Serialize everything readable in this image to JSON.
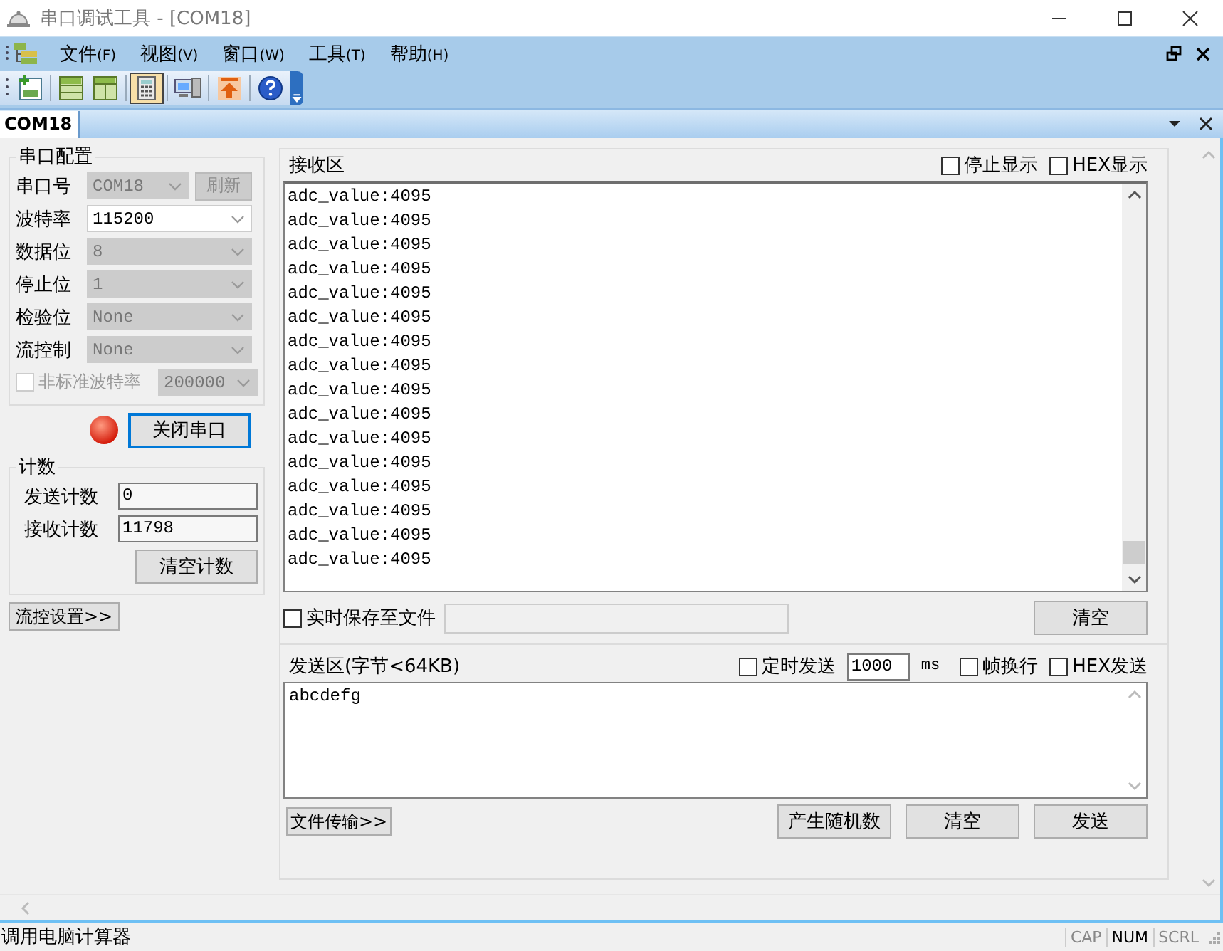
{
  "window": {
    "title": "串口调试工具 - [COM18]"
  },
  "menu": [
    {
      "label": "文件",
      "key": "(F)"
    },
    {
      "label": "视图",
      "key": "(V)"
    },
    {
      "label": "窗口",
      "key": "(W)"
    },
    {
      "label": "工具",
      "key": "(T)"
    },
    {
      "label": "帮助",
      "key": "(H)"
    }
  ],
  "toolbar": [
    {
      "kind": "new"
    },
    {
      "kind": "sep"
    },
    {
      "kind": "rows"
    },
    {
      "kind": "cols"
    },
    {
      "kind": "sep"
    },
    {
      "kind": "calc",
      "selected": true
    },
    {
      "kind": "sep"
    },
    {
      "kind": "pc"
    },
    {
      "kind": "sep"
    },
    {
      "kind": "upload"
    },
    {
      "kind": "sep"
    },
    {
      "kind": "help"
    }
  ],
  "doc_tabs": [
    {
      "label": "COM18",
      "selected": true
    }
  ],
  "serial_config": {
    "title": "串口配置",
    "fields": [
      {
        "label": "串口号",
        "value": "COM18",
        "disabled": true,
        "button": "刷新"
      },
      {
        "label": "波特率",
        "value": "115200",
        "disabled": false
      },
      {
        "label": "数据位",
        "value": "8",
        "disabled": true
      },
      {
        "label": "停止位",
        "value": "1",
        "disabled": true
      },
      {
        "label": "检验位",
        "value": "None",
        "disabled": true
      },
      {
        "label": "流控制",
        "value": "None",
        "disabled": true
      }
    ],
    "custom_baud": {
      "label": "非标准波特率",
      "checked": false,
      "disabled": true,
      "value": "200000"
    }
  },
  "port": {
    "open": true,
    "button": "关闭串口",
    "focused": true
  },
  "counts": {
    "title": "计数",
    "rows": [
      {
        "label": "发送计数",
        "value": "0"
      },
      {
        "label": "接收计数",
        "value": "11798"
      }
    ],
    "clear_button": "清空计数"
  },
  "flow_button": "流控设置>>",
  "receive": {
    "title": "接收区",
    "options": [
      {
        "label": "停止显示",
        "checked": false
      },
      {
        "label": "HEX显示",
        "checked": false
      }
    ],
    "lines": [
      "adc_value:4095",
      "adc_value:4095",
      "adc_value:4095",
      "adc_value:4095",
      "adc_value:4095",
      "adc_value:4095",
      "adc_value:4095",
      "adc_value:4095",
      "adc_value:4095",
      "adc_value:4095",
      "adc_value:4095",
      "adc_value:4095",
      "adc_value:4095",
      "adc_value:4095",
      "adc_value:4095",
      "adc_value:4095"
    ],
    "save": {
      "label": "实时保存至文件",
      "checked": false
    },
    "clear_button": "清空"
  },
  "send": {
    "title": "发送区(字节<64KB)",
    "timed": {
      "label": "定时发送",
      "checked": false,
      "interval": "1000",
      "unit": "ms"
    },
    "options": [
      {
        "label": "帧换行",
        "checked": false
      },
      {
        "label": "HEX发送",
        "checked": false
      }
    ],
    "text": "abcdefg",
    "file_button": "文件传输>>",
    "buttons": [
      "产生随机数",
      "清空",
      "发送"
    ]
  },
  "status_bar": {
    "message": "调用电脑计算器",
    "indicators": [
      {
        "label": "CAP",
        "on": false
      },
      {
        "label": "NUM",
        "on": true
      },
      {
        "label": "SCRL",
        "on": false
      }
    ]
  }
}
